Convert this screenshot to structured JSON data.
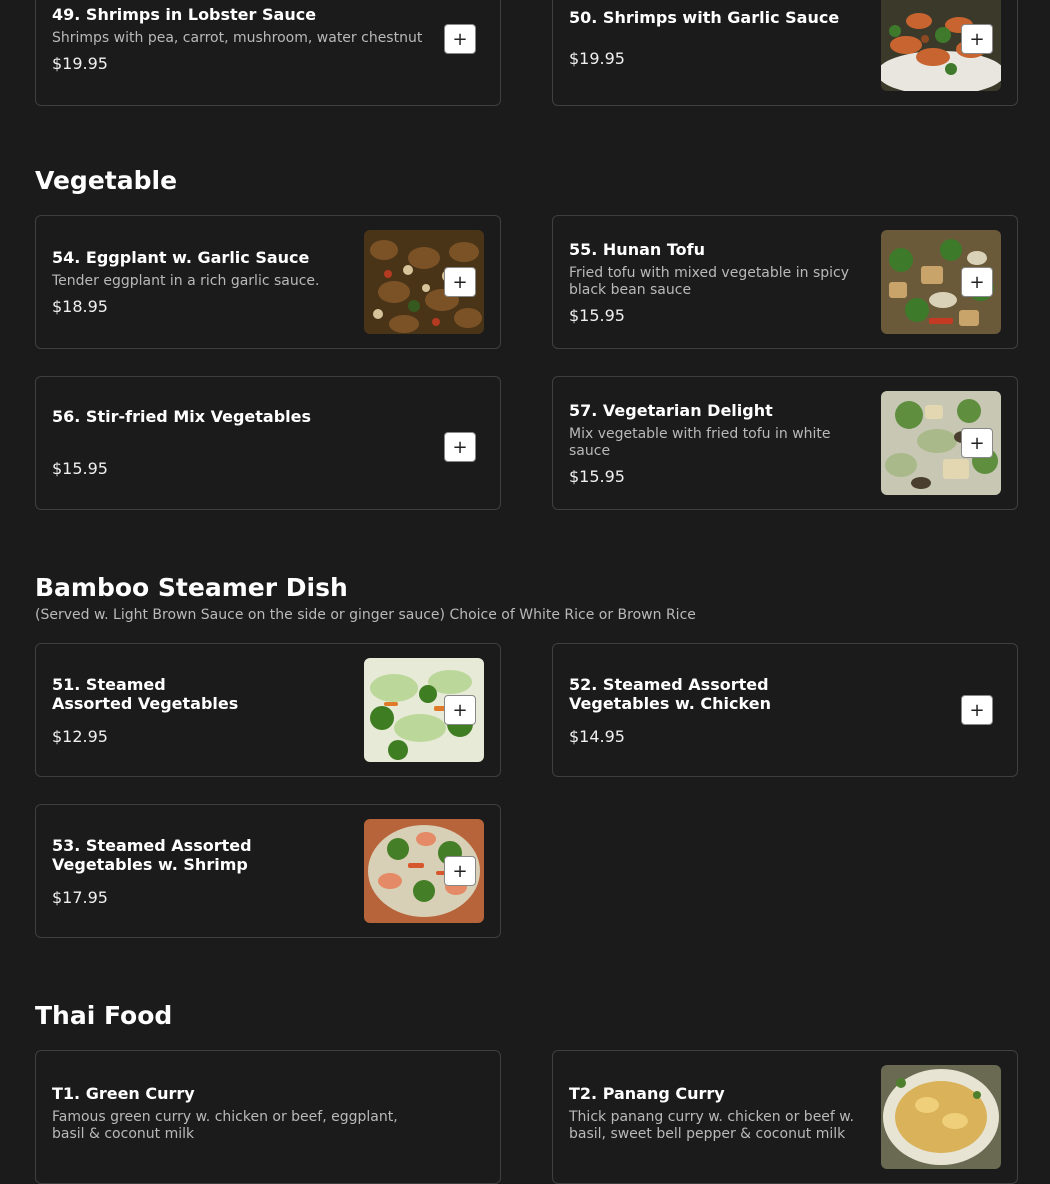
{
  "sections": {
    "vegetable": {
      "title": "Vegetable"
    },
    "bamboo": {
      "title": "Bamboo Steamer Dish",
      "subtitle": "(Served w. Light Brown Sauce on the side or ginger sauce) Choice of White Rice or Brown Rice"
    },
    "thai": {
      "title": "Thai Food"
    }
  },
  "add_label": "+",
  "items": {
    "i49": {
      "name": "49. Shrimps in Lobster Sauce",
      "desc": "Shrimps with pea, carrot, mushroom, water chestnut",
      "price": "$19.95"
    },
    "i50": {
      "name": "50. Shrimps with Garlic Sauce",
      "desc": "",
      "price": "$19.95"
    },
    "i54": {
      "name": "54. Eggplant w. Garlic Sauce",
      "desc": "Tender eggplant in a rich garlic sauce.",
      "price": "$18.95"
    },
    "i55": {
      "name": "55. Hunan Tofu",
      "desc": "Fried tofu with mixed vegetable in spicy black bean sauce",
      "price": "$15.95"
    },
    "i56": {
      "name": "56. Stir-fried Mix Vegetables",
      "desc": "",
      "price": "$15.95"
    },
    "i57": {
      "name": "57. Vegetarian Delight",
      "desc": "Mix vegetable with fried tofu in white sauce",
      "price": "$15.95"
    },
    "i51": {
      "name": "51. Steamed\nAssorted Vegetables",
      "desc": "",
      "price": "$12.95"
    },
    "i52": {
      "name": "52. Steamed Assorted\nVegetables w. Chicken",
      "desc": "",
      "price": "$14.95"
    },
    "i53": {
      "name": "53. Steamed Assorted\nVegetables w. Shrimp",
      "desc": "",
      "price": "$17.95"
    },
    "t1": {
      "name": "T1. Green Curry",
      "desc": "Famous green curry w. chicken or beef, eggplant, basil & coconut milk",
      "price": ""
    },
    "t2": {
      "name": "T2. Panang Curry",
      "desc": "Thick panang curry w. chicken or beef w. basil, sweet bell pepper & coconut milk",
      "price": ""
    }
  }
}
